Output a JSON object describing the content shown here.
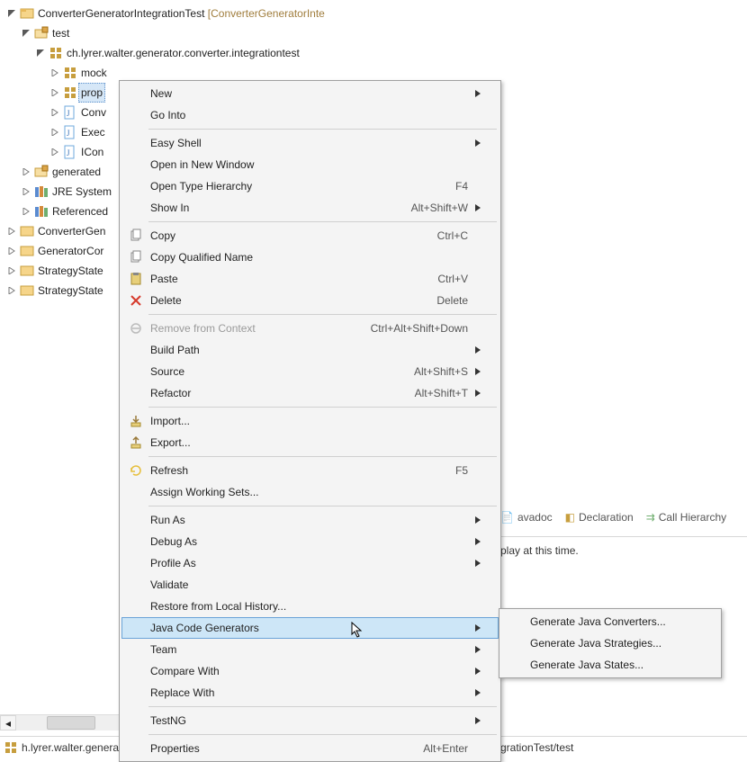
{
  "tree": {
    "root": {
      "label": "ConverterGeneratorIntegrationTest",
      "decor": "[ConverterGeneratorInte"
    },
    "nodes": {
      "test": "test",
      "pkg": "ch.lyrer.walter.generator.converter.integrationtest",
      "mock": "mock",
      "prop": "prop",
      "conv": "Conv",
      "exec": "Exec",
      "icon": "ICon",
      "generated": "generated",
      "jre": "JRE System",
      "ref": "Referenced",
      "convgen": "ConverterGen",
      "gencor": "GeneratorCor",
      "strat1": "StrategyState",
      "strat2": "StrategyState"
    }
  },
  "menu": [
    {
      "type": "item",
      "label": "New",
      "sub": true
    },
    {
      "type": "item",
      "label": "Go Into"
    },
    {
      "type": "sep"
    },
    {
      "type": "item",
      "label": "Easy Shell",
      "sub": true
    },
    {
      "type": "item",
      "label": "Open in New Window"
    },
    {
      "type": "item",
      "label": "Open Type Hierarchy",
      "shortcut": "F4"
    },
    {
      "type": "item",
      "label": "Show In",
      "shortcut": "Alt+Shift+W",
      "sub": true
    },
    {
      "type": "sep"
    },
    {
      "type": "item",
      "label": "Copy",
      "shortcut": "Ctrl+C",
      "icon": "copy"
    },
    {
      "type": "item",
      "label": "Copy Qualified Name",
      "icon": "copyq"
    },
    {
      "type": "item",
      "label": "Paste",
      "shortcut": "Ctrl+V",
      "icon": "paste"
    },
    {
      "type": "item",
      "label": "Delete",
      "shortcut": "Delete",
      "icon": "delete"
    },
    {
      "type": "sep"
    },
    {
      "type": "item",
      "label": "Remove from Context",
      "shortcut": "Ctrl+Alt+Shift+Down",
      "disabled": true,
      "icon": "remove"
    },
    {
      "type": "item",
      "label": "Build Path",
      "sub": true
    },
    {
      "type": "item",
      "label": "Source",
      "shortcut": "Alt+Shift+S",
      "sub": true
    },
    {
      "type": "item",
      "label": "Refactor",
      "shortcut": "Alt+Shift+T",
      "sub": true
    },
    {
      "type": "sep"
    },
    {
      "type": "item",
      "label": "Import...",
      "icon": "import"
    },
    {
      "type": "item",
      "label": "Export...",
      "icon": "export"
    },
    {
      "type": "sep"
    },
    {
      "type": "item",
      "label": "Refresh",
      "shortcut": "F5",
      "icon": "refresh"
    },
    {
      "type": "item",
      "label": "Assign Working Sets..."
    },
    {
      "type": "sep"
    },
    {
      "type": "item",
      "label": "Run As",
      "sub": true
    },
    {
      "type": "item",
      "label": "Debug As",
      "sub": true
    },
    {
      "type": "item",
      "label": "Profile As",
      "sub": true
    },
    {
      "type": "item",
      "label": "Validate"
    },
    {
      "type": "item",
      "label": "Restore from Local History..."
    },
    {
      "type": "item",
      "label": "Java Code Generators",
      "sub": true,
      "hover": true
    },
    {
      "type": "item",
      "label": "Team",
      "sub": true
    },
    {
      "type": "item",
      "label": "Compare With",
      "sub": true
    },
    {
      "type": "item",
      "label": "Replace With",
      "sub": true
    },
    {
      "type": "sep"
    },
    {
      "type": "item",
      "label": "TestNG",
      "sub": true
    },
    {
      "type": "sep"
    },
    {
      "type": "item",
      "label": "Properties",
      "shortcut": "Alt+Enter"
    }
  ],
  "submenu": [
    {
      "label": "Generate Java Converters..."
    },
    {
      "label": "Generate Java Strategies..."
    },
    {
      "label": "Generate Java States..."
    }
  ],
  "bottom_tabs": {
    "javadoc": "avadoc",
    "declaration": "Declaration",
    "callhierarchy": "Call Hierarchy"
  },
  "info_text": "play at this time.",
  "status": {
    "left": "h.lyrer.walter.genera",
    "right": "grationTest/test"
  }
}
